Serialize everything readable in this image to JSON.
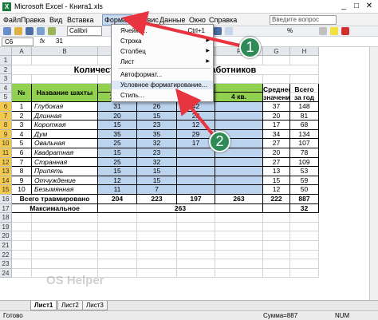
{
  "window": {
    "title": "Microsoft Excel - Книга1.xls",
    "icon_letter": "X",
    "controls": [
      "_",
      "□",
      "✕"
    ]
  },
  "menubar": {
    "items": [
      "Файл",
      "Правка",
      "Вид",
      "Вставка",
      "Формат",
      "Сервис",
      "Данные",
      "Окно",
      "Справка"
    ],
    "active": "Формат",
    "ask_placeholder": "Введите вопрос"
  },
  "toolbar": {
    "font": "Calibri",
    "zoom_hint": "%"
  },
  "formula_bar": {
    "cell_ref": "C6",
    "fx": "fx",
    "value": "31"
  },
  "columns": [
    "A",
    "B",
    "C",
    "D",
    "E",
    "F",
    "G",
    "H"
  ],
  "rows": [
    "1",
    "2",
    "3",
    "4",
    "5",
    "6",
    "7",
    "8",
    "9",
    "10",
    "11",
    "12",
    "13",
    "14",
    "15",
    "16",
    "17",
    "18",
    "19",
    "20",
    "21",
    "22",
    "23",
    "24"
  ],
  "sheet": {
    "title": "Количество травмированных работников",
    "headers": {
      "num": "№",
      "name": "Название шахты",
      "q1": "1 кв.",
      "q2": "2 кв.",
      "q3": "3 кв.",
      "q4": "4 кв.",
      "mean": "Среднее значение",
      "total": "Всего за год"
    },
    "mines": [
      {
        "n": "1",
        "name": "Глубокая",
        "q1": "31",
        "q2": "26",
        "q3": "42",
        "q4": "",
        "mean": "37",
        "total": "148"
      },
      {
        "n": "2",
        "name": "Длинная",
        "q1": "20",
        "q2": "15",
        "q3": "23",
        "q4": "",
        "mean": "20",
        "total": "81"
      },
      {
        "n": "3",
        "name": "Короткая",
        "q1": "15",
        "q2": "23",
        "q3": "12",
        "q4": "",
        "mean": "17",
        "total": "68"
      },
      {
        "n": "4",
        "name": "Дум",
        "q1": "35",
        "q2": "35",
        "q3": "29",
        "q4": "",
        "mean": "34",
        "total": "134"
      },
      {
        "n": "5",
        "name": "Овальная",
        "q1": "25",
        "q2": "32",
        "q3": "17",
        "q4": "",
        "mean": "27",
        "total": "107"
      },
      {
        "n": "6",
        "name": "Квадратная",
        "q1": "15",
        "q2": "23",
        "q3": "",
        "q4": "",
        "mean": "20",
        "total": "78"
      },
      {
        "n": "7",
        "name": "Странная",
        "q1": "25",
        "q2": "32",
        "q3": "",
        "q4": "",
        "mean": "27",
        "total": "109"
      },
      {
        "n": "8",
        "name": "Припять",
        "q1": "15",
        "q2": "15",
        "q3": "",
        "q4": "",
        "mean": "13",
        "total": "53"
      },
      {
        "n": "9",
        "name": "Отчуждение",
        "q1": "12",
        "q2": "15",
        "q3": "",
        "q4": "",
        "mean": "15",
        "total": "59"
      },
      {
        "n": "10",
        "name": "Безымянная",
        "q1": "11",
        "q2": "7",
        "q3": "",
        "q4": "",
        "mean": "12",
        "total": "50"
      }
    ],
    "total_row": {
      "label": "Всего травмировано",
      "q1": "204",
      "q2": "223",
      "q3": "197",
      "q4": "263",
      "mean": "222",
      "total": "887"
    },
    "max_row": {
      "label": "Максимальное",
      "value": "263",
      "total": "32"
    }
  },
  "format_menu": {
    "items": [
      {
        "label": "Ячейки...",
        "shortcut": "Ctrl+1",
        "arrow": ""
      },
      {
        "label": "Строка",
        "shortcut": "",
        "arrow": "▶"
      },
      {
        "label": "Столбец",
        "shortcut": "",
        "arrow": "▶"
      },
      {
        "label": "Лист",
        "shortcut": "",
        "arrow": "▶"
      },
      {
        "label": "Автоформат...",
        "shortcut": "",
        "arrow": ""
      },
      {
        "label": "Условное форматирование...",
        "shortcut": "",
        "arrow": ""
      },
      {
        "label": "Стиль...",
        "shortcut": "",
        "arrow": ""
      }
    ]
  },
  "callouts": [
    "1",
    "2"
  ],
  "sheet_tabs": [
    "Лист1",
    "Лист2",
    "Лист3"
  ],
  "status": {
    "left": "Готово",
    "sum": "Сумма=887",
    "mode": "NUM"
  },
  "watermark": "OS Helper",
  "colors": {
    "selection": "#bcd3ee",
    "header_green": "#92d050",
    "callout": "#2e8b57",
    "arrow": "#e8343e"
  }
}
